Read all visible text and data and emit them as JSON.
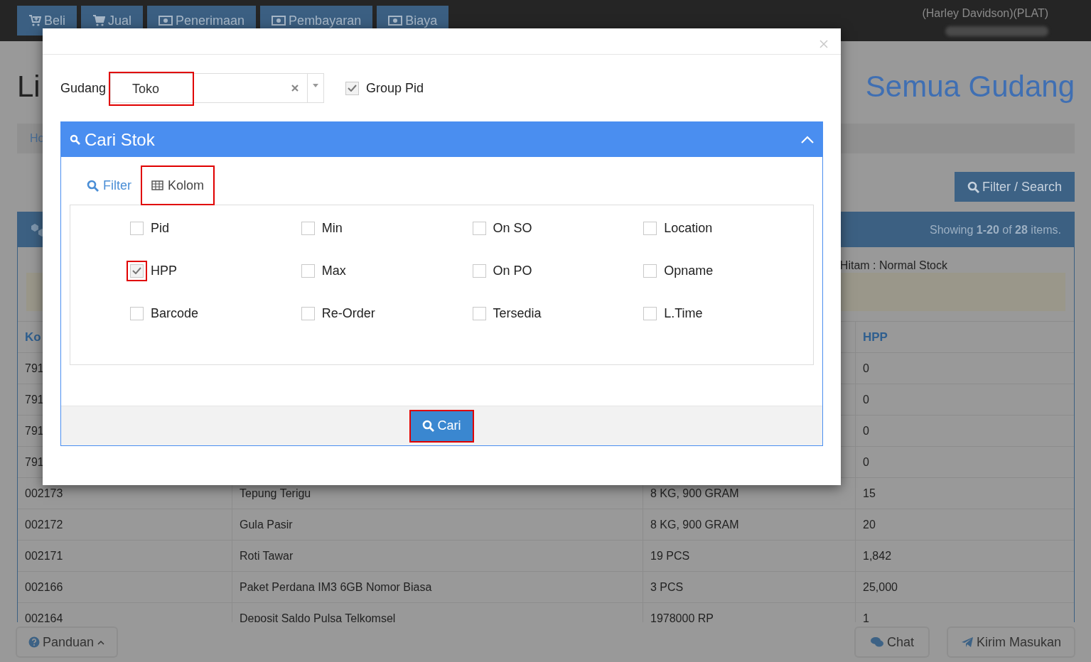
{
  "navbar": {
    "tabs": [
      {
        "label": "Beli",
        "kind": "buy"
      },
      {
        "label": "Jual",
        "kind": "sell"
      },
      {
        "label": "Penerimaan",
        "kind": "cash"
      },
      {
        "label": "Pembayaran",
        "kind": "cash"
      },
      {
        "label": "Biaya",
        "kind": "cash"
      }
    ],
    "user": "(Harley Davidson)(PLAT)"
  },
  "page": {
    "title": "Li",
    "subtitle": "Semua Gudang",
    "breadcrumb": "Ho",
    "filter_button": "Filter / Search",
    "summary": "Showing **1-20** of **28** items.",
    "legend": "Hitam : Normal Stock",
    "table": {
      "first_header": "Ko",
      "last_header": "HPP",
      "rows": [
        {
          "code": "791",
          "hpp": "0"
        },
        {
          "code": "791",
          "hpp": "0"
        },
        {
          "code": "791",
          "hpp": "0"
        },
        {
          "code": "791",
          "hpp": "0"
        },
        {
          "code": "002173",
          "name": "Tepung Terigu",
          "qty": "8 KG, 900 GRAM",
          "hpp": "15"
        },
        {
          "code": "002172",
          "name": "Gula Pasir",
          "qty": "8 KG, 900 GRAM",
          "hpp": "20"
        },
        {
          "code": "002171",
          "name": "Roti Tawar",
          "qty": "19 PCS",
          "hpp": "1,842"
        },
        {
          "code": "002166",
          "name": "Paket Perdana IM3 6GB Nomor Biasa",
          "qty": "3 PCS",
          "hpp": "25,000"
        },
        {
          "code": "002164",
          "name": "Deposit Saldo Pulsa Telkomsel",
          "qty": "1978000 RP",
          "hpp": "1"
        }
      ]
    }
  },
  "modal": {
    "gudang_label": "Gudang",
    "gudang_value": {
      "text": "Toko",
      "highlighted": true
    },
    "group_pid": {
      "label": "Group Pid",
      "checked": true
    },
    "panel": {
      "title": "Cari Stok",
      "expanded": true,
      "tabs": [
        {
          "label": "Filter",
          "kind": "filter",
          "selected": false,
          "highlighted": false
        },
        {
          "label": "Kolom",
          "kind": "columns",
          "selected": true,
          "highlighted": true
        }
      ],
      "columns": [
        {
          "label": "Pid",
          "checked": false,
          "highlighted": false
        },
        {
          "label": "Min",
          "checked": false,
          "highlighted": false
        },
        {
          "label": "On SO",
          "checked": false,
          "highlighted": false
        },
        {
          "label": "Location",
          "checked": false,
          "highlighted": false
        },
        {
          "label": "HPP",
          "checked": true,
          "highlighted": true
        },
        {
          "label": "Max",
          "checked": false,
          "highlighted": false
        },
        {
          "label": "On PO",
          "checked": false,
          "highlighted": false
        },
        {
          "label": "Opname",
          "checked": false,
          "highlighted": false
        },
        {
          "label": "Barcode",
          "checked": false,
          "highlighted": false
        },
        {
          "label": "Re-Order",
          "checked": false,
          "highlighted": false
        },
        {
          "label": "Tersedia",
          "checked": false,
          "highlighted": false
        },
        {
          "label": "L.Time",
          "checked": false,
          "highlighted": false
        }
      ],
      "search_button": {
        "label": "Cari",
        "highlighted": true
      }
    }
  },
  "footer": {
    "guide": "Panduan",
    "chat": "Chat",
    "feedback": "Kirim Masukan"
  }
}
